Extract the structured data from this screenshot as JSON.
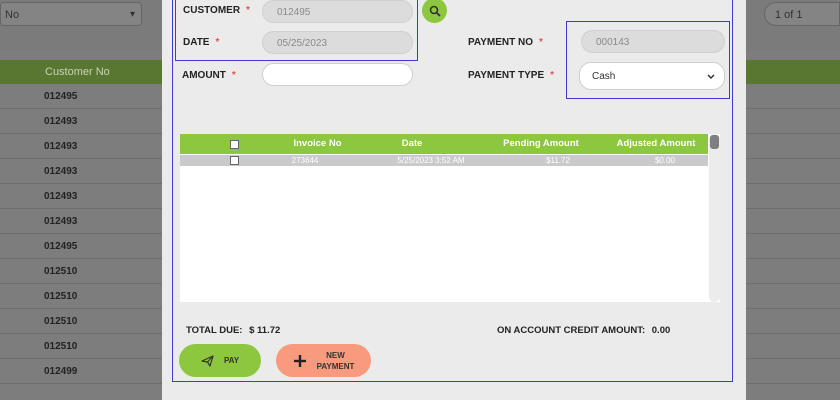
{
  "background": {
    "filter_select": "No",
    "pager": "1 of 1",
    "column_header": "Customer No",
    "rows": [
      "012495",
      "012493",
      "012493",
      "012493",
      "012493",
      "012493",
      "012495",
      "012510",
      "012510",
      "012510",
      "012510",
      "012499"
    ]
  },
  "form": {
    "customer_label": "CUSTOMER",
    "customer_value": "012495",
    "date_label": "DATE",
    "date_value": "05/25/2023",
    "amount_label": "AMOUNT",
    "amount_value": "",
    "payment_no_label": "PAYMENT NO",
    "payment_no_value": "000143",
    "payment_type_label": "PAYMENT TYPE",
    "payment_type_value": "Cash",
    "required_marker": "*"
  },
  "grid": {
    "columns": [
      "Invoice No",
      "Date",
      "Pending Amount",
      "Adjusted Amount"
    ],
    "rows": [
      {
        "invoice_no": "273644",
        "date": "5/25/2023 3:52 AM",
        "pending": "$11.72",
        "adjusted": "$0.00"
      }
    ]
  },
  "summary": {
    "total_due_label": "TOTAL DUE:",
    "total_due_value": "$ 11.72",
    "credit_label": "ON ACCOUNT CREDIT AMOUNT:",
    "credit_value": "0.00"
  },
  "buttons": {
    "pay": "PAY",
    "new_payment_line1": "NEW",
    "new_payment_line2": "PAYMENT"
  },
  "colors": {
    "accent_green": "#8dc63f",
    "new_payment": "#f79a7d",
    "highlight_border": "#3b3bd6",
    "required": "#e05555"
  },
  "icons": [
    "search-icon",
    "chevron-down-icon",
    "paper-plane-icon",
    "plus-icon"
  ]
}
